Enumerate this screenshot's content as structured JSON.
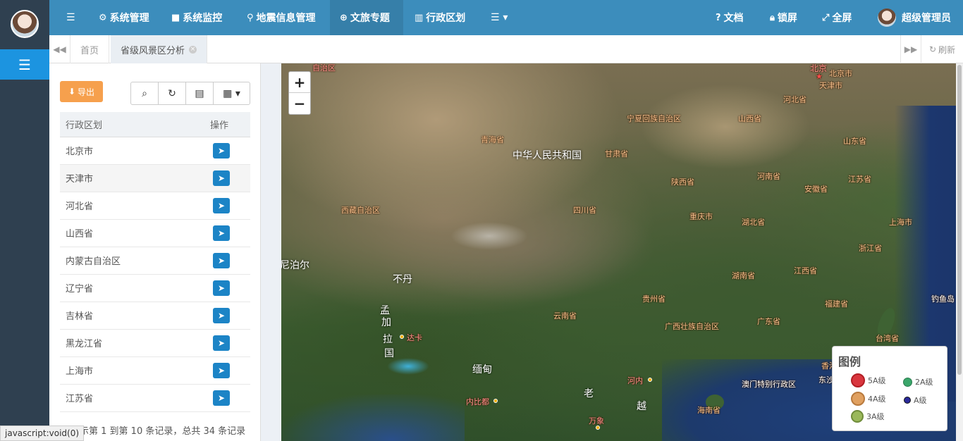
{
  "topnav": {
    "menu_icon": "hamburger-icon",
    "items": [
      {
        "label": "系统管理",
        "icon": "gear-icon"
      },
      {
        "label": "系统监控",
        "icon": "video-camera-icon"
      },
      {
        "label": "地震信息管理",
        "icon": "map-marker-icon"
      },
      {
        "label": "文旅专题",
        "icon": "globe-icon"
      },
      {
        "label": "行政区划",
        "icon": "bank-icon"
      },
      {
        "label": "",
        "icon": "list-dropdown-icon"
      }
    ],
    "right": {
      "docs": "文档",
      "lock": "锁屏",
      "fullscreen": "全屏",
      "user": "超级管理员"
    }
  },
  "tabs": {
    "home": "首页",
    "active": "省级风景区分析",
    "refresh": "刷新"
  },
  "panel": {
    "export_label": "导出",
    "table": {
      "headers": [
        "行政区划",
        "操作"
      ],
      "rows": [
        "北京市",
        "天津市",
        "河北省",
        "山西省",
        "内蒙古自治区",
        "辽宁省",
        "吉林省",
        "黑龙江省",
        "上海市",
        "江苏省"
      ]
    },
    "pagination": "显示第 1 到第 10 条记录，总共 34 条记录"
  },
  "map": {
    "zoom_in": "+",
    "zoom_out": "−",
    "labels": {
      "xinjiang": "自治区",
      "beijing": "北京",
      "beijing_shi": "北京市",
      "tianjin": "天津市",
      "hebei": "河北省",
      "ningxia": "宁夏回族自治区",
      "shanxi": "山西省",
      "qinghai": "青海省",
      "china": "中华人民共和国",
      "gansu": "甘肃省",
      "shandong": "山东省",
      "shaanxi": "陕西省",
      "henan": "河南省",
      "jiangsu": "江苏省",
      "anhui": "安徽省",
      "tibet": "西藏自治区",
      "sichuan": "四川省",
      "chongqing": "重庆市",
      "hubei": "湖北省",
      "shanghai": "上海市",
      "zhejiang": "浙江省",
      "nepal": "尼泊尔",
      "bhutan": "不丹",
      "hunan": "湖南省",
      "jiangxi": "江西省",
      "guizhou": "贵州省",
      "fujian": "福建省",
      "diaoyu": "钓鱼岛",
      "yunnan": "云南省",
      "guangxi": "广西壮族自治区",
      "guangdong": "广东省",
      "taiwan": "台湾省",
      "bangladesh_1": "孟",
      "bangladesh_2": "加",
      "bangladesh_3": "拉",
      "bangladesh_4": "国",
      "dhaka": "达卡",
      "myanmar": "缅甸",
      "naypyidaw": "内比都",
      "laos": "老",
      "vietnam": "越",
      "hanoi": "河内",
      "vientiane": "万象",
      "macau": "澳门特别行政区",
      "hongkong": "香港",
      "dongsha": "东沙",
      "hainan": "海南省"
    },
    "legend": {
      "title": "图例",
      "items": [
        {
          "label": "5A级",
          "color": "#d9363e"
        },
        {
          "label": "2A级",
          "color": "#3aa66a"
        },
        {
          "label": "4A级",
          "color": "#e0a060"
        },
        {
          "label": "A级",
          "color": "#2a2a9a"
        },
        {
          "label": "3A级",
          "color": "#9ab85a"
        }
      ]
    }
  },
  "statusbar": "javascript:void(0)"
}
